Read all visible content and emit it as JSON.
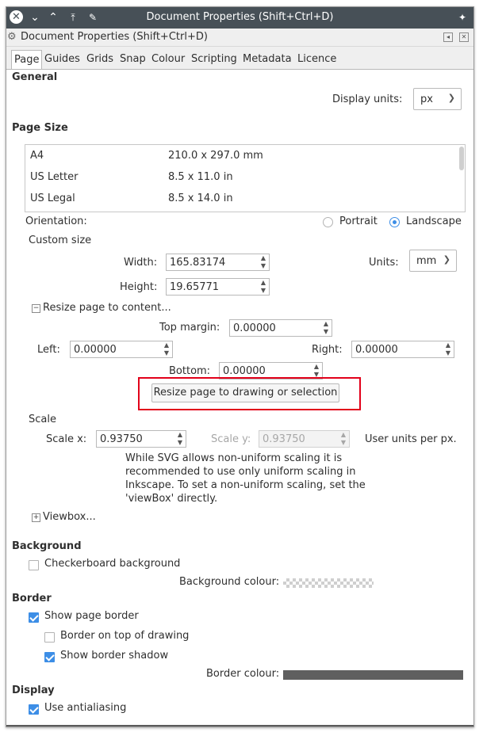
{
  "window": {
    "title": "Document Properties (Shift+Ctrl+D)"
  },
  "dock": {
    "title": "Document Properties (Shift+Ctrl+D)"
  },
  "tabs": [
    "Page",
    "Guides",
    "Grids",
    "Snap",
    "Colour",
    "Scripting",
    "Metadata",
    "Licence"
  ],
  "general": {
    "heading": "General",
    "display_units_label": "Display units:",
    "display_units_value": "px"
  },
  "page_size": {
    "heading": "Page Size",
    "rows": [
      {
        "name": "A4",
        "size": "210.0 x 297.0 mm"
      },
      {
        "name": "US Letter",
        "size": "8.5 x 11.0 in"
      },
      {
        "name": "US Legal",
        "size": "8.5 x 14.0 in"
      }
    ],
    "orientation_label": "Orientation:",
    "portrait_label": "Portrait",
    "landscape_label": "Landscape",
    "custom_size_label": "Custom size",
    "width_label": "Width:",
    "width_value": "165.83174",
    "height_label": "Height:",
    "height_value": "19.65771",
    "units_label": "Units:",
    "units_value": "mm",
    "resize_expander_label": "Resize page to content...",
    "top_margin_label": "Top margin:",
    "top_margin_value": "0.00000",
    "left_label": "Left:",
    "left_value": "0.00000",
    "right_label": "Right:",
    "right_value": "0.00000",
    "bottom_label": "Bottom:",
    "bottom_value": "0.00000",
    "resize_button_label": "Resize page to drawing or selection"
  },
  "scale": {
    "heading": "Scale",
    "scale_x_label": "Scale x:",
    "scale_x_value": "0.93750",
    "scale_y_label": "Scale y:",
    "scale_y_value": "0.93750",
    "units_per_px_label": "User units per px.",
    "note_lines": [
      "While SVG allows non-uniform scaling it is",
      "recommended to use only uniform scaling in",
      "Inkscape. To set a non-uniform scaling, set the",
      "'viewBox' directly."
    ],
    "viewbox_expander_label": "Viewbox..."
  },
  "background": {
    "heading": "Background",
    "checkerboard_label": "Checkerboard background",
    "colour_label": "Background colour:"
  },
  "border": {
    "heading": "Border",
    "show_border_label": "Show page border",
    "border_on_top_label": "Border on top of drawing",
    "border_shadow_label": "Show border shadow",
    "colour_label": "Border colour:",
    "colour": "#5f5f5f"
  },
  "display": {
    "heading": "Display",
    "antialiasing_label": "Use antialiasing"
  },
  "colors": {
    "titlebar": "#475057",
    "accent": "#3d8ee6",
    "highlight": "#e2001a"
  }
}
